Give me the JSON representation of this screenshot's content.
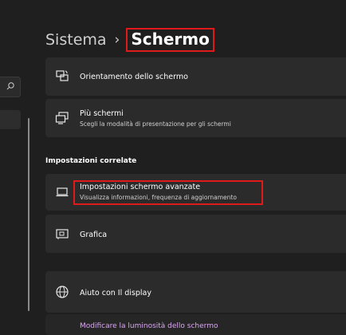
{
  "header": {
    "parent": "Sistema",
    "separator": "›",
    "current": "Schermo"
  },
  "cards": {
    "orientation": {
      "label": "Orientamento dello schermo",
      "icon": "screen-rotation-icon"
    },
    "multiple": {
      "label": "Più schermi",
      "sub": "Scegli la modalità di presentazione per gli schermi",
      "icon": "multiple-displays-icon"
    },
    "advanced": {
      "label": "Impostazioni schermo avanzate",
      "sub": "Visualizza informazioni, frequenza di aggiornamento",
      "icon": "monitor-icon"
    },
    "graphics": {
      "label": "Grafica",
      "icon": "graphics-card-icon"
    },
    "help": {
      "label": "Aiuto con Il display",
      "icon": "globe-icon"
    }
  },
  "related_title": "Impostazioni correlate",
  "help_link": "Modificare la luminosità dello schermo",
  "sidebar": {
    "search_icon": "search-icon"
  },
  "colors": {
    "background": "#1f1f1f",
    "card": "#2b2b2b",
    "highlight": "#e01a1a",
    "link": "#d9a7f0"
  }
}
